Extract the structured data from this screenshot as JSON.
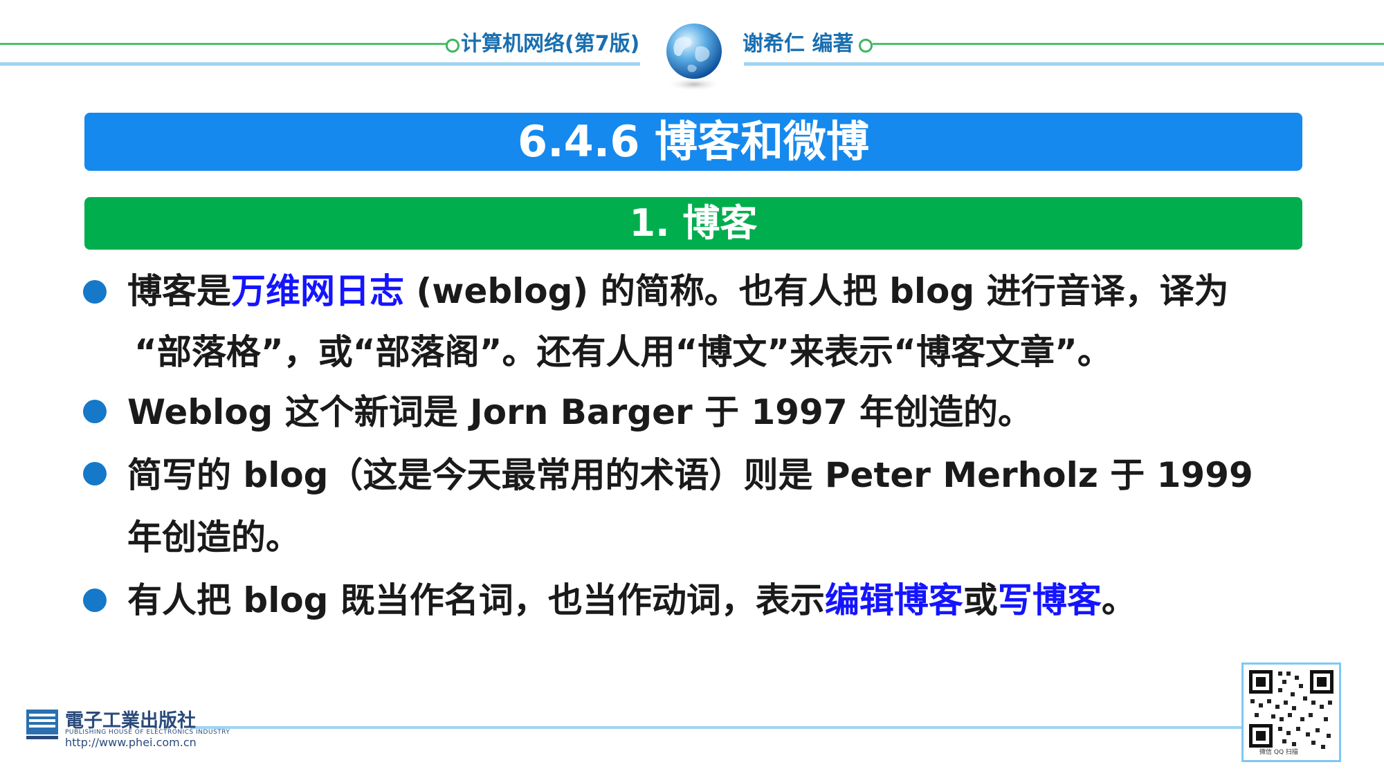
{
  "header": {
    "book_title": "计算机网络(第7版)",
    "author": "谢希仁 编著",
    "globe_icon": "globe-icon"
  },
  "section_title": "6.4.6 博客和微博",
  "subsection_title": "1. 博客",
  "bullets": [
    {
      "lines": [
        [
          {
            "text": "博客是",
            "highlight": false
          },
          {
            "text": "万维网日志",
            "highlight": true
          },
          {
            "text": " (weblog) 的简称。也有人把 blog 进行音译，译为",
            "highlight": false
          }
        ],
        [
          {
            "text": "“部落格”，或“部落阁”。还有人用“博文”来表示“博客文章”。",
            "highlight": false
          }
        ]
      ]
    },
    {
      "lines": [
        [
          {
            "text": "Weblog 这个新词是 Jorn Barger 于 1997 年创造的。",
            "highlight": false
          }
        ]
      ]
    },
    {
      "lines": [
        [
          {
            "text": "简写的 blog（这是今天最常用的术语）则是 Peter Merholz 于 1999",
            "highlight": false
          }
        ],
        [
          {
            "text": "年创造的。",
            "highlight": false
          }
        ]
      ]
    },
    {
      "lines": [
        [
          {
            "text": "有人把 blog 既当作名词，也当作动词，表示",
            "highlight": false
          },
          {
            "text": "编辑博客",
            "highlight": true
          },
          {
            "text": "或",
            "highlight": false
          },
          {
            "text": "写博客",
            "highlight": true
          },
          {
            "text": "。",
            "highlight": false
          }
        ]
      ]
    }
  ],
  "footer": {
    "publisher_name": "電子工業出版社",
    "publisher_sub": "PUBLISHING HOUSE OF ELECTRONICS INDUSTRY",
    "publisher_url": "http://www.phei.com.cn",
    "qr_caption": "微信 QQ 扫描"
  },
  "colors": {
    "title_bar": "#1589ee",
    "subtitle_bar": "#00ae4d",
    "highlight": "#1414ff",
    "bullet": "#1578c8"
  }
}
